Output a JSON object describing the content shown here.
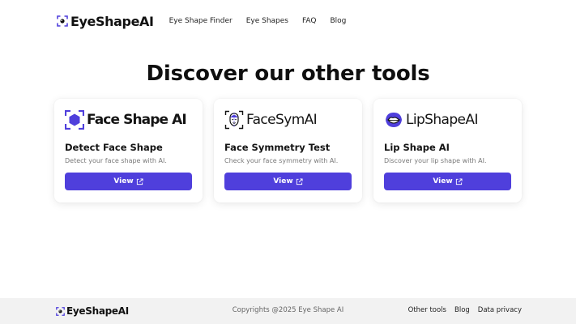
{
  "header": {
    "brand": "EyeShapeAI",
    "nav": [
      "Eye Shape Finder",
      "Eye Shapes",
      "FAQ",
      "Blog"
    ]
  },
  "main": {
    "heading": "Discover our other tools",
    "cards": [
      {
        "logo_text": "Face Shape AI",
        "title": "Detect Face Shape",
        "description": "Detect your face shape with AI.",
        "button": "View"
      },
      {
        "logo_text": "FaceSymAI",
        "title": "Face Symmetry Test",
        "description": "Check your face symmetry with AI.",
        "button": "View"
      },
      {
        "logo_text": "LipShapeAI",
        "title": "Lip Shape AI",
        "description": "Discover your lip shape with AI.",
        "button": "View"
      }
    ]
  },
  "footer": {
    "brand": "EyeShapeAI",
    "copyright": "Copyrights @2025 Eye Shape AI",
    "links": [
      "Other tools",
      "Blog",
      "Data privacy"
    ]
  },
  "colors": {
    "accent": "#4f3fdc",
    "footer_bg": "#f2f2f2"
  }
}
